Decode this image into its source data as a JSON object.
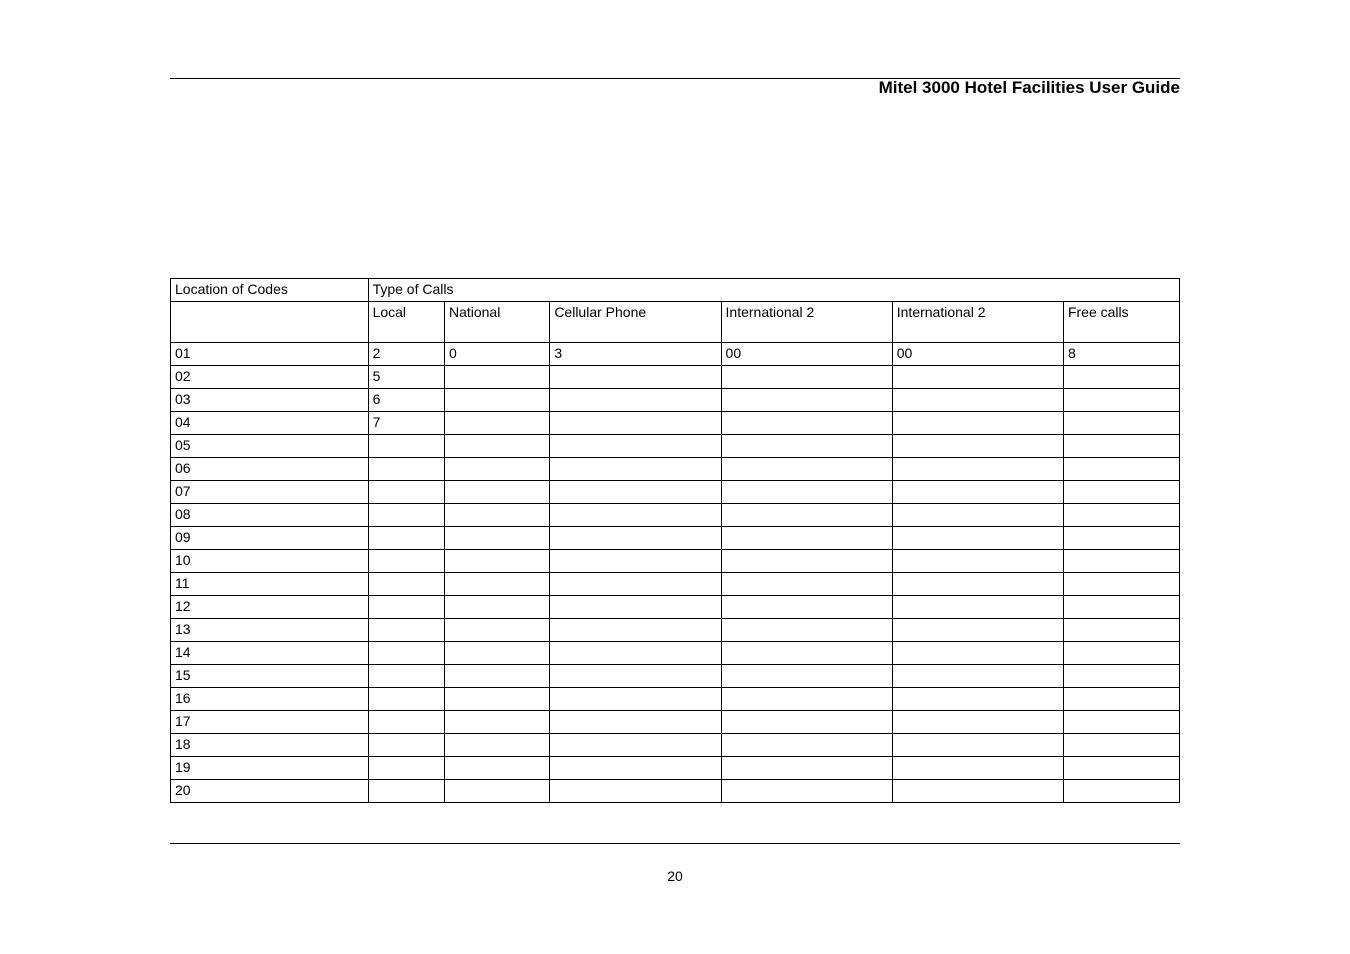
{
  "doc": {
    "title": "Mitel 3000 Hotel Facilities User Guide",
    "page_number": "20"
  },
  "table": {
    "headers": {
      "location": "Location of Codes",
      "type_of_calls": "Type of Calls",
      "local": "Local",
      "national": "National",
      "cellular": "Cellular Phone",
      "intl1": "International 2",
      "intl2": "International 2",
      "free": "Free calls"
    },
    "rows": [
      {
        "loc": "01",
        "local": "2",
        "national": "0",
        "cellular": "3",
        "intl1": "00",
        "intl2": "00",
        "free": "8"
      },
      {
        "loc": "02",
        "local": "5",
        "national": "",
        "cellular": "",
        "intl1": "",
        "intl2": "",
        "free": ""
      },
      {
        "loc": "03",
        "local": "6",
        "national": "",
        "cellular": "",
        "intl1": "",
        "intl2": "",
        "free": ""
      },
      {
        "loc": "04",
        "local": "7",
        "national": "",
        "cellular": "",
        "intl1": "",
        "intl2": "",
        "free": ""
      },
      {
        "loc": "05",
        "local": "",
        "national": "",
        "cellular": "",
        "intl1": "",
        "intl2": "",
        "free": ""
      },
      {
        "loc": "06",
        "local": "",
        "national": "",
        "cellular": "",
        "intl1": "",
        "intl2": "",
        "free": ""
      },
      {
        "loc": "07",
        "local": "",
        "national": "",
        "cellular": "",
        "intl1": "",
        "intl2": "",
        "free": ""
      },
      {
        "loc": "08",
        "local": "",
        "national": "",
        "cellular": "",
        "intl1": "",
        "intl2": "",
        "free": ""
      },
      {
        "loc": "09",
        "local": "",
        "national": "",
        "cellular": "",
        "intl1": "",
        "intl2": "",
        "free": ""
      },
      {
        "loc": "10",
        "local": "",
        "national": "",
        "cellular": "",
        "intl1": "",
        "intl2": "",
        "free": ""
      },
      {
        "loc": "11",
        "local": "",
        "national": "",
        "cellular": "",
        "intl1": "",
        "intl2": "",
        "free": ""
      },
      {
        "loc": "12",
        "local": "",
        "national": "",
        "cellular": "",
        "intl1": "",
        "intl2": "",
        "free": ""
      },
      {
        "loc": "13",
        "local": "",
        "national": "",
        "cellular": "",
        "intl1": "",
        "intl2": "",
        "free": ""
      },
      {
        "loc": "14",
        "local": "",
        "national": "",
        "cellular": "",
        "intl1": "",
        "intl2": "",
        "free": ""
      },
      {
        "loc": "15",
        "local": "",
        "national": "",
        "cellular": "",
        "intl1": "",
        "intl2": "",
        "free": ""
      },
      {
        "loc": "16",
        "local": "",
        "national": "",
        "cellular": "",
        "intl1": "",
        "intl2": "",
        "free": ""
      },
      {
        "loc": "17",
        "local": "",
        "national": "",
        "cellular": "",
        "intl1": "",
        "intl2": "",
        "free": ""
      },
      {
        "loc": "18",
        "local": "",
        "national": "",
        "cellular": "",
        "intl1": "",
        "intl2": "",
        "free": ""
      },
      {
        "loc": "19",
        "local": "",
        "national": "",
        "cellular": "",
        "intl1": "",
        "intl2": "",
        "free": ""
      },
      {
        "loc": "20",
        "local": "",
        "national": "",
        "cellular": "",
        "intl1": "",
        "intl2": "",
        "free": ""
      }
    ]
  }
}
